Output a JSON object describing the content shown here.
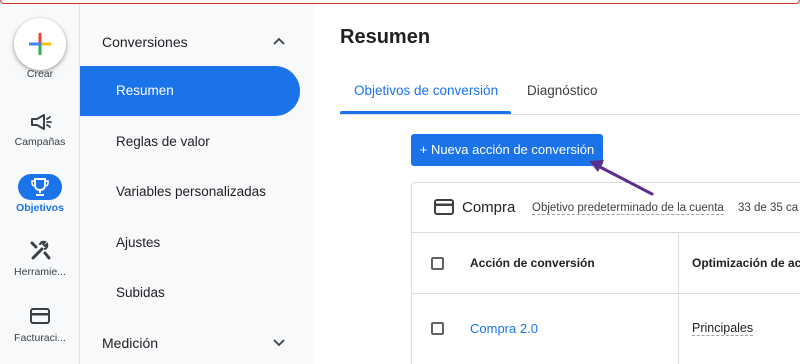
{
  "rail": {
    "create_label": "Crear",
    "items": [
      {
        "label": "Campañas",
        "icon": "megaphone-icon"
      },
      {
        "label": "Objetivos",
        "icon": "trophy-icon"
      },
      {
        "label": "Herramie...",
        "icon": "tools-icon"
      },
      {
        "label": "Facturaci...",
        "icon": "credit-card-icon"
      }
    ]
  },
  "subnav": {
    "section_conversiones": "Conversiones",
    "items": [
      "Resumen",
      "Reglas de valor",
      "Variables personalizadas",
      "Ajustes",
      "Subidas"
    ],
    "section_medicion": "Medición"
  },
  "main": {
    "title": "Resumen",
    "tabs": [
      "Objetivos de conversión",
      "Diagnóstico"
    ],
    "new_button": "+ Nueva acción de conversión",
    "card": {
      "title": "Compra",
      "subtitle": "Objetivo predeterminado de la cuenta",
      "count": "33 de 35 ca",
      "headers": [
        "Acción de conversión",
        "Optimización de ac"
      ],
      "rows": [
        {
          "action": "Compra 2.0",
          "optimization": "Principales"
        }
      ]
    }
  },
  "colors": {
    "accent": "#1a73e8",
    "arrow": "#5b2d8e",
    "alert": "#d93025"
  }
}
